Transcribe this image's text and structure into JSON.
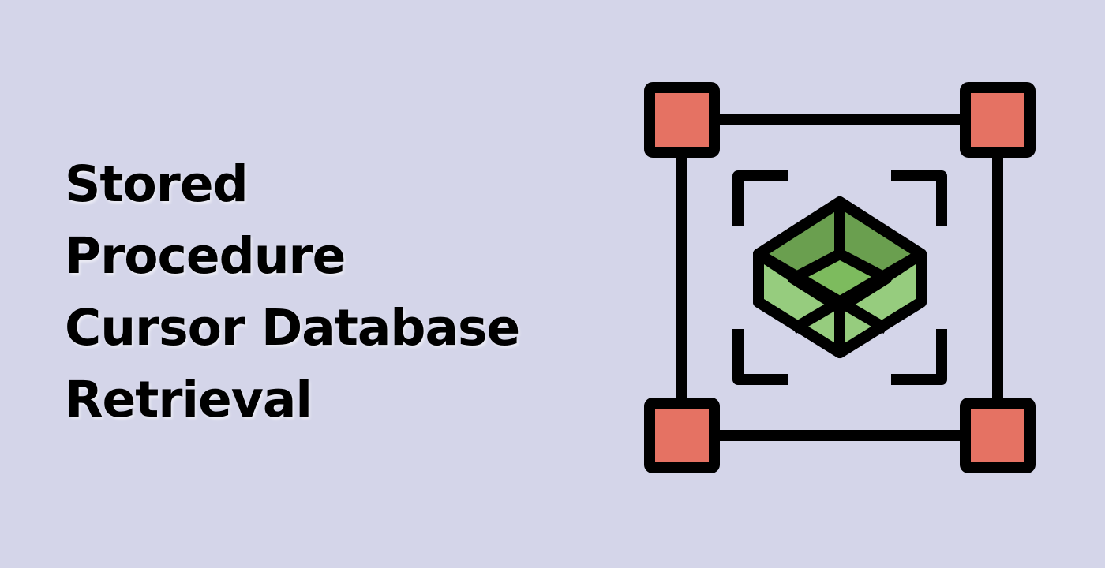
{
  "title": {
    "lines": [
      "Stored",
      "Procedure",
      "Cursor Database",
      "Retrieval"
    ]
  },
  "colors": {
    "background": "#d4d5e9",
    "text": "#000000",
    "corner_fill": "#e57263",
    "cube_dark": "#6a9f4f",
    "cube_mid": "#7dbb5e",
    "cube_light": "#96cc7e",
    "stroke": "#000000"
  },
  "illustration": {
    "icon": "selection-box-cube-icon"
  }
}
